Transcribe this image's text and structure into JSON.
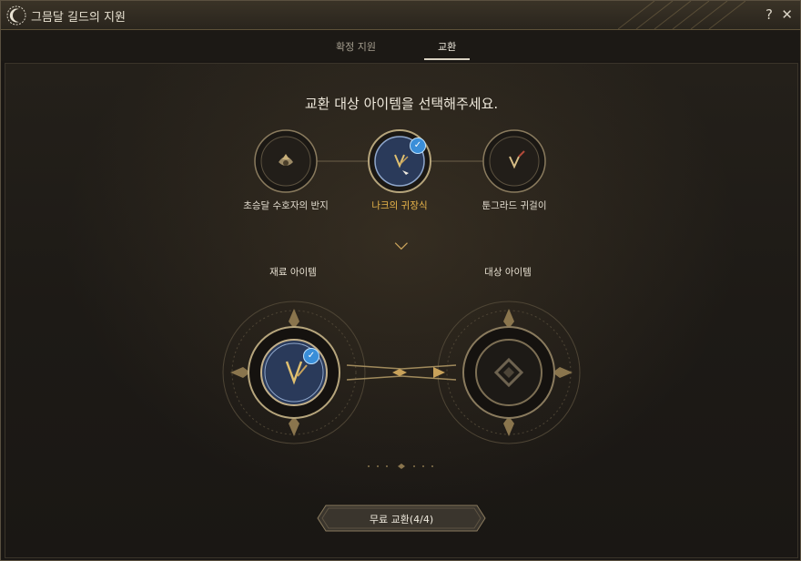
{
  "window": {
    "title": "그믐달 길드의 지원",
    "help_label": "?",
    "close_label": "✕",
    "logo_icon": "crescent-moon-icon"
  },
  "tabs": [
    {
      "label": "확정 지원",
      "active": false
    },
    {
      "label": "교환",
      "active": true
    }
  ],
  "heading": "교환 대상 아이템을 선택해주세요.",
  "items": [
    {
      "label": "초승달 수호자의 반지",
      "icon": "ring-icon",
      "selected": false
    },
    {
      "label": "나크의 귀장식",
      "icon": "earring-icon",
      "selected": true
    },
    {
      "label": "툰그라드 귀걸이",
      "icon": "earring-icon",
      "selected": false
    }
  ],
  "material": {
    "label": "재료 아이템",
    "icon": "earring-icon",
    "checked": true
  },
  "target": {
    "label": "대상 아이템",
    "icon": "diamond-placeholder-icon"
  },
  "exchange_button": {
    "label": "무료 교환(4/4)"
  },
  "colors": {
    "accent_gold": "#c9a25a",
    "selected_label": "#e8b54a",
    "check_blue": "#3a8ed8",
    "background": "#1a1714"
  }
}
